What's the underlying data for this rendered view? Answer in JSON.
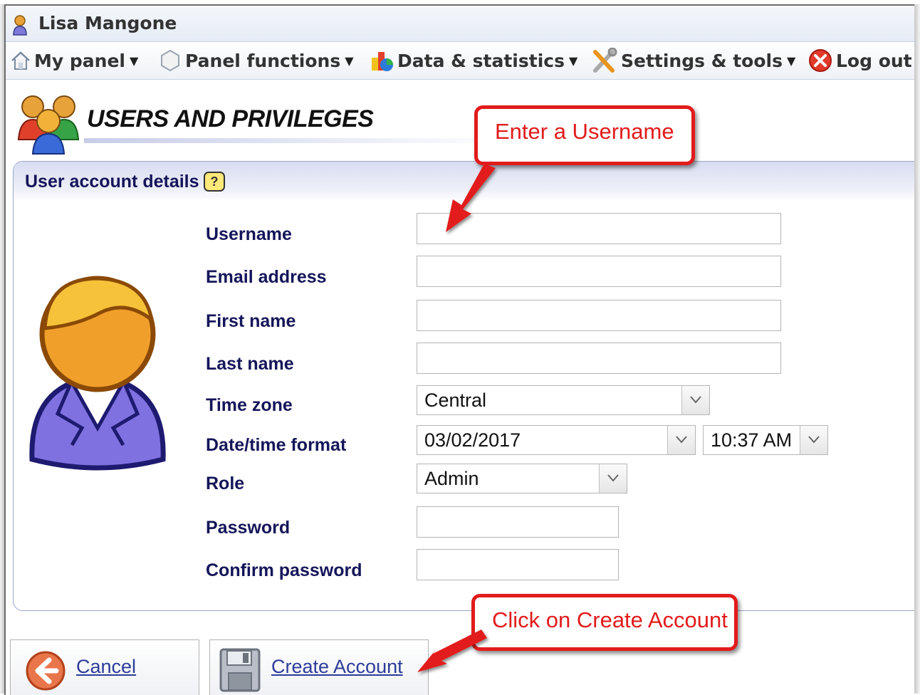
{
  "titlebar": {
    "user_name": "Lisa Mangone"
  },
  "menu": [
    {
      "label": "My panel",
      "icon": "home-icon"
    },
    {
      "label": "Panel functions",
      "icon": "hexagon-icon"
    },
    {
      "label": "Data & statistics",
      "icon": "statistics-icon"
    },
    {
      "label": "Settings & tools",
      "icon": "tools-icon"
    },
    {
      "label": "Log out",
      "icon": "close-icon"
    }
  ],
  "page": {
    "title": "USERS AND PRIVILEGES"
  },
  "panel": {
    "title": "User account details",
    "help_icon": "?",
    "fields": {
      "username": {
        "label": "Username",
        "value": ""
      },
      "email": {
        "label": "Email address",
        "value": ""
      },
      "first_name": {
        "label": "First name",
        "value": ""
      },
      "last_name": {
        "label": "Last name",
        "value": ""
      },
      "time_zone": {
        "label": "Time zone",
        "value": "Central"
      },
      "date_time_format": {
        "label": "Date/time format",
        "date_value": "03/02/2017",
        "time_value": "10:37 AM"
      },
      "role": {
        "label": "Role",
        "value": "Admin"
      },
      "password": {
        "label": "Password",
        "value": ""
      },
      "confirm_password": {
        "label": "Confirm password",
        "value": ""
      }
    }
  },
  "buttons": {
    "cancel": "Cancel",
    "create_account": "Create Account"
  },
  "annotations": {
    "username_callout": "Enter a Username",
    "create_callout": "Click on Create Account"
  },
  "colors": {
    "accent_red": "#e21b1b",
    "label_navy": "#15155a",
    "link_blue": "#2c3c9a"
  }
}
